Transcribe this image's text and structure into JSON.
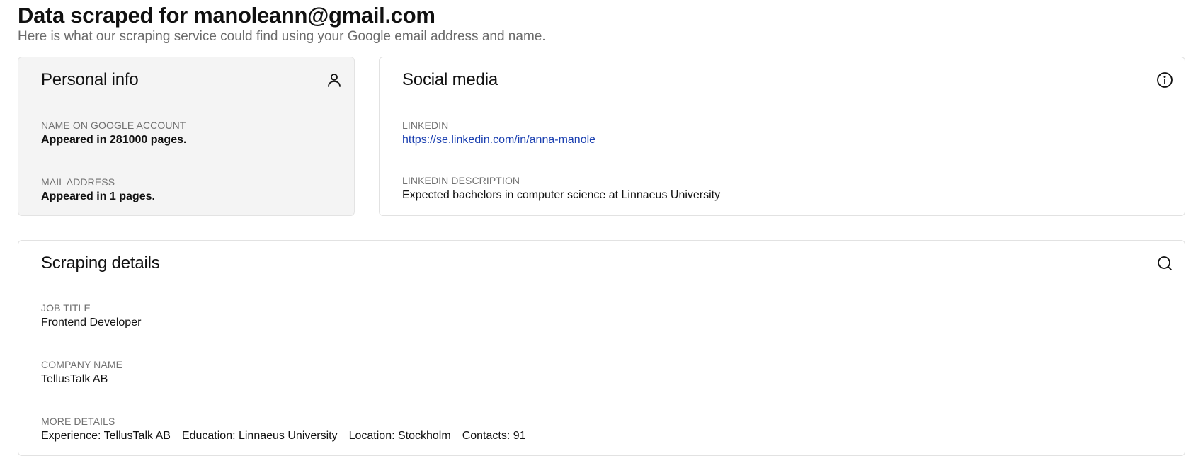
{
  "header": {
    "title": "Data scraped for manoleann@gmail.com",
    "subtitle": "Here is what our scraping service could find using your Google email address and name."
  },
  "personal_info": {
    "title": "Personal info",
    "icon": "user-icon",
    "fields": [
      {
        "label": "Name on Google Account",
        "value": "Appeared in 281000 pages."
      },
      {
        "label": "Mail address",
        "value": "Appeared in 1 pages."
      }
    ]
  },
  "social_media": {
    "title": "Social media",
    "icon": "info-icon",
    "linkedin_label": "LinkedIn",
    "linkedin_url": "https://se.linkedin.com/in/anna-manole",
    "description_label": "LinkedIn description",
    "description": "Expected bachelors in computer science at Linnaeus University"
  },
  "scraping_details": {
    "title": "Scraping details",
    "icon": "search-icon",
    "job_title_label": "Job title",
    "job_title": "Frontend Developer",
    "company_label": "Company name",
    "company": "TellusTalk AB",
    "more_label": "More details",
    "more": [
      "Experience: TellusTalk AB",
      "Education: Linnaeus University",
      "Location: Stockholm",
      "Contacts: 91"
    ]
  },
  "colors": {
    "link": "#1a3fb0",
    "card_gray": "#f4f4f4",
    "muted_text": "#707070"
  }
}
